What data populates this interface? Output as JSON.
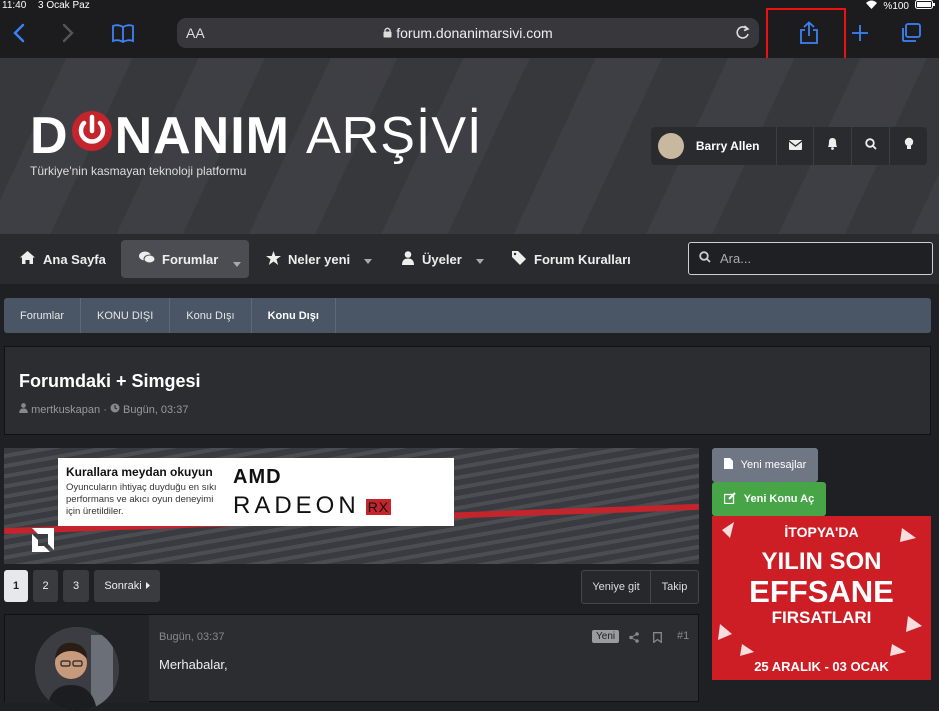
{
  "status": {
    "time": "11:40",
    "date": "3 Ocak Paz",
    "battery": "%100"
  },
  "browser": {
    "text_size": "AA",
    "url": "forum.donanimarsivi.com"
  },
  "site": {
    "logo_part1": "D",
    "logo_part2": "NANIM",
    "logo_part3": "ARŞİVİ",
    "tagline": "Türkiye'nin kasmayan teknoloji platformu"
  },
  "user": {
    "name": "Barry Allen"
  },
  "nav": {
    "home": "Ana Sayfa",
    "forums": "Forumlar",
    "whats_new": "Neler yeni",
    "members": "Üyeler",
    "rules": "Forum Kuralları",
    "search_placeholder": "Ara..."
  },
  "breadcrumb": [
    "Forumlar",
    "KONU DIŞI",
    "Konu Dışı",
    "Konu Dışı"
  ],
  "thread": {
    "title": "Forumdaki + Simgesi",
    "author": "mertkuskapan",
    "time": "Bugün, 03:37"
  },
  "banner": {
    "heading": "Kurallara meydan okuyun",
    "text": "Oyuncuların ihtiyaç duyduğu en sıkı performans ve akıcı oyun deneyimi için üretildiler.",
    "brand": "AMD",
    "product": "RADEON",
    "rx": "RX"
  },
  "side": {
    "new_posts": "Yeni mesajlar",
    "new_thread": "Yeni Konu Aç"
  },
  "ad": {
    "brand": "İTOPYA'DA",
    "line1": "YILIN SON",
    "line2": "EFFSANE",
    "line3": "FIRSATLARI",
    "dates": "25 ARALIK - 03 OCAK"
  },
  "pagination": {
    "p1": "1",
    "p2": "2",
    "p3": "3",
    "next": "Sonraki"
  },
  "thread_tools": {
    "goto_new": "Yeniye git",
    "follow": "Takip"
  },
  "post": {
    "date": "Bugün, 03:37",
    "badge": "Yeni",
    "number": "#1",
    "body": "Merhabalar,"
  },
  "colors": {
    "accent_red": "#c4242b",
    "breadcrumb_bg": "#4a5665",
    "green": "#47a447",
    "highlight": "#ee1111"
  }
}
